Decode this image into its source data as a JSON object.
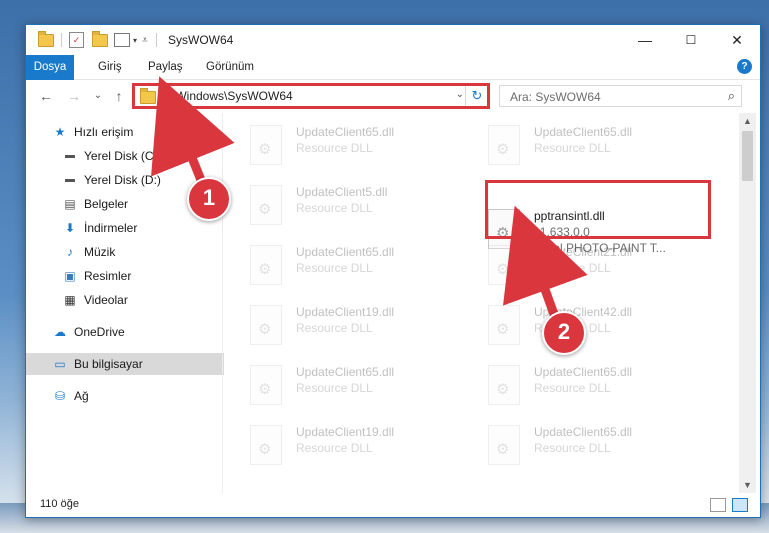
{
  "window": {
    "title": "SysWOW64",
    "controls": {
      "minimize": "—",
      "maximize": "☐",
      "close": "✕"
    }
  },
  "ribbon": {
    "tabs": [
      "Dosya",
      "Giriş",
      "Paylaş",
      "Görünüm"
    ],
    "help": "?"
  },
  "navigation": {
    "back": "←",
    "forward": "→",
    "recent": "⌄",
    "up": "↑",
    "address": "C:\\Windows\\SysWOW64",
    "address_dropdown": "⌄",
    "refresh": "↻",
    "search_placeholder": "Ara: SysWOW64",
    "search_icon": "⌕"
  },
  "sidebar": {
    "items": [
      {
        "label": "Hızlı erişim",
        "icon": "star-icon",
        "pinned": false
      },
      {
        "label": "Yerel Disk (C:)",
        "icon": "drive-icon",
        "pinned": true
      },
      {
        "label": "Yerel Disk (D:)",
        "icon": "drive-icon",
        "pinned": true
      },
      {
        "label": "Belgeler",
        "icon": "document-icon",
        "pinned": true
      },
      {
        "label": "İndirmeler",
        "icon": "download-icon",
        "pinned": true
      },
      {
        "label": "Müzik",
        "icon": "music-icon",
        "pinned": true
      },
      {
        "label": "Resimler",
        "icon": "pictures-icon",
        "pinned": true
      },
      {
        "label": "Videolar",
        "icon": "video-icon",
        "pinned": true
      },
      {
        "label": "OneDrive",
        "icon": "cloud-icon",
        "pinned": false
      },
      {
        "label": "Bu bilgisayar",
        "icon": "computer-icon",
        "pinned": false,
        "selected": true
      },
      {
        "label": "Ağ",
        "icon": "network-icon",
        "pinned": false
      }
    ]
  },
  "files": {
    "left_column": [
      {
        "name": "UpdateClient65.dll",
        "type": "Resource DLL"
      },
      {
        "name": "UpdateClient5.dll",
        "type": "Resource DLL"
      },
      {
        "name": "UpdateClient65.dll",
        "type": "Resource DLL"
      },
      {
        "name": "UpdateClient19.dll",
        "type": "Resource DLL"
      },
      {
        "name": "UpdateClient65.dll",
        "type": "Resource DLL"
      },
      {
        "name": "UpdateClient19.dll",
        "type": "Resource DLL"
      }
    ],
    "right_column": [
      {
        "name": "UpdateClient65.dll",
        "type": "Resource DLL"
      },
      {
        "name": "pptransintl.dll",
        "version": "11.633.0.0",
        "description": "Corel PHOTO-PAINT T...",
        "highlighted": true
      },
      {
        "name": "UpdateClient21.dll",
        "type": "Resource DLL"
      },
      {
        "name": "UpdateClient42.dll",
        "type": "Resource DLL"
      },
      {
        "name": "UpdateClient65.dll",
        "type": "Resource DLL"
      },
      {
        "name": "UpdateClient65.dll",
        "type": "Resource DLL"
      }
    ]
  },
  "status": {
    "item_count": "110 öğe"
  },
  "annotations": [
    {
      "number": "1",
      "color": "#d9363e"
    },
    {
      "number": "2",
      "color": "#d9363e"
    }
  ],
  "colors": {
    "accent": "#1979ca",
    "annotation": "#d9363e"
  }
}
